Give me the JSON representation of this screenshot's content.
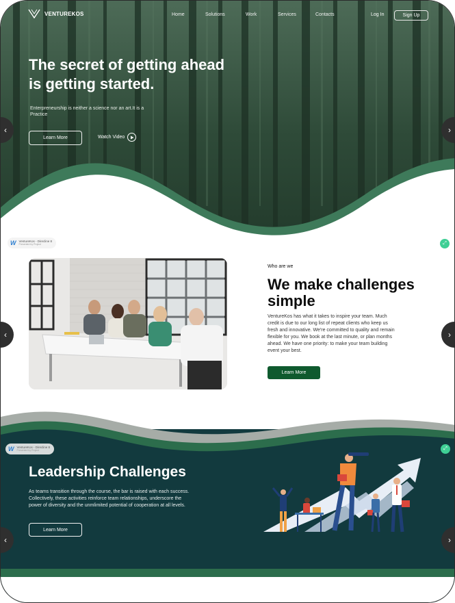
{
  "nav": {
    "brand": "VENTUREKOS",
    "links": [
      "Home",
      "Solutions",
      "Work",
      "Services",
      "Contacts"
    ],
    "login": "Log In",
    "signup": "Sign Up"
  },
  "hero": {
    "title_line1": "The secret of getting ahead",
    "title_line2": "is getting started.",
    "subtitle": "Enterpreneurship is neither a science nor an art.It is a Practice",
    "learn_more": "Learn More",
    "watch_video": "Watch Video"
  },
  "badges": {
    "title": "VentureKos - Direcline 8",
    "subtitle": "Presented by Project"
  },
  "about": {
    "label": "Who are we",
    "title": "We make challenges simple",
    "text": "VentureKos has what it takes to inspire your team. Much credit is due to our long list of repeat clients who keep us fresh and innovative. We're committed to quality and remain flexible for you. We book at the last minute, or plan months ahead. We have one priority: to make your team building event your best.",
    "button": "Learn More"
  },
  "leadership": {
    "title": "Leadership Challenges",
    "text": "As teams transition through the course, the bar is raised with each success. Collectively, these activities reinforce team relationships, underscore the power of diversity and the unmlimited potential of cooperation at all levels.",
    "button": "Learn More"
  },
  "colors": {
    "forest": "#2f4a36",
    "wave_green": "#3e7a5a",
    "dark_teal": "#123a3e",
    "button_green": "#0f5a2e",
    "share": "#3fcf95"
  },
  "icons": [
    "logo-icon",
    "play-icon",
    "share-icon",
    "arrow-left-icon",
    "arrow-right-icon"
  ]
}
